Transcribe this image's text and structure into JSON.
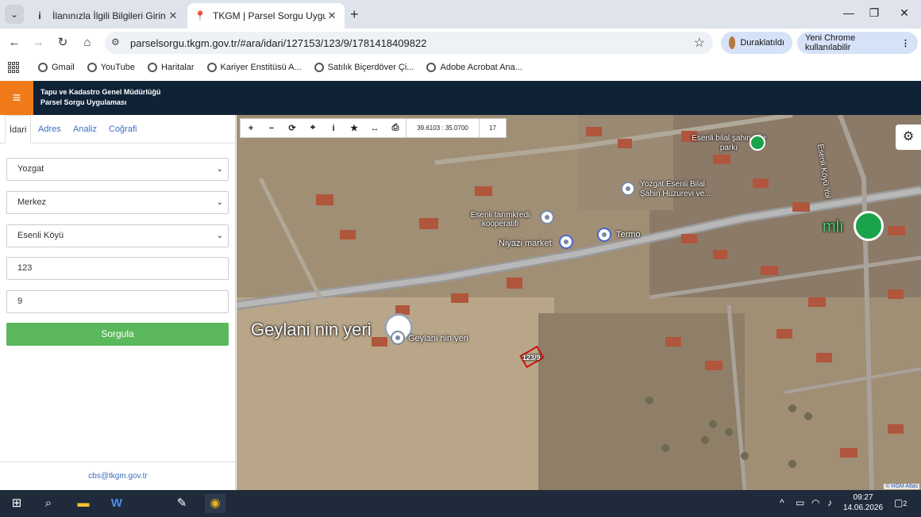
{
  "browser": {
    "tabs": [
      {
        "title": "İlanınızla İlgili Bilgileri Girin",
        "icon": "info-icon"
      },
      {
        "title": "TKGM | Parsel Sorgu Uygulama",
        "icon": "location-pin-icon"
      }
    ],
    "url": "parselsorgu.tkgm.gov.tr/#ara/idari/127153/123/9/1781418409822",
    "profile_label": "Duraklatıldı",
    "chrome_label": "Yeni Chrome kullanılabilir",
    "bookmarks": [
      "Gmail",
      "YouTube",
      "Haritalar",
      "Kariyer Enstitüsü A...",
      "Satılık Biçerdöver Çi...",
      "Adobe Acrobat Ana..."
    ]
  },
  "app": {
    "title_line1": "Tapu ve Kadastro Genel Müdürlüğü",
    "title_line2": "Parsel Sorgu Uygulaması",
    "accent": "#f07a1a",
    "header_bg": "#0f2236"
  },
  "sidebar": {
    "tabs": [
      "İdari",
      "Adres",
      "Analiz",
      "Coğrafi"
    ],
    "il": "Yozgat",
    "ilce": "Merkez",
    "mahalle": "Esenli Köyü",
    "ada": "123",
    "parsel": "9",
    "query_button": "Sorgula",
    "footer_email": "cbs@tkgm.gov.tr"
  },
  "map": {
    "coordinates": "39.6103 : 35.0700",
    "zoom": "17",
    "labels": {
      "park": "Esenli bilal şahin Aile parkı",
      "huzurevi": "Yozgat Esenli Bilal Şahin Huzurevi ve...",
      "kooperatif": "Esenli tarımkredi kooperatifi",
      "termo": "Termo",
      "market": "Niyazi market",
      "road": "Esenli Köyü Yol",
      "mli": "mlı",
      "geylani_big": "Geylani nin yeri",
      "geylani_small": "Geylani nin yeri",
      "parcel": "123/9"
    },
    "attribution": "© HGM Atlas"
  },
  "taskbar": {
    "time": "09:27",
    "date": "14.06.2026",
    "notifications": "2"
  }
}
